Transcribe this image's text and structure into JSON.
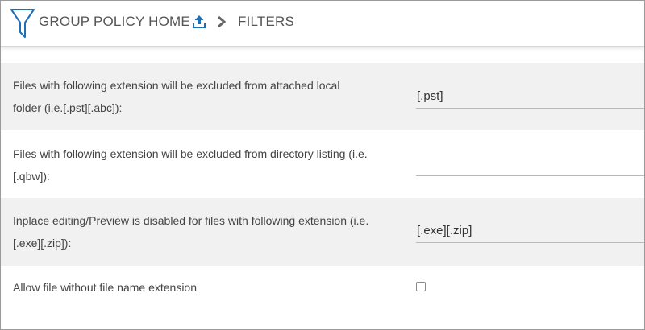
{
  "header": {
    "home_label": "GROUP POLICY HOME",
    "current_label": "FILTERS",
    "icons": {
      "logo": "filter-icon",
      "upload": "upload-icon",
      "separator": "chevron-right-icon"
    },
    "colors": {
      "accent": "#1f6fb5",
      "separator": "#666666"
    }
  },
  "settings": [
    {
      "label_line1": "Files with following extension will be excluded from attached local",
      "label_line2": "folder (i.e.[.pst][.abc]):",
      "value": "[.pst]"
    },
    {
      "label_line1": "Files with following extension will be excluded from directory listing (i.e.",
      "label_line2": "[.qbw]):",
      "value": ""
    },
    {
      "label_line1": "Inplace editing/Preview is disabled for files with following extension (i.e.",
      "label_line2": "[.exe][.zip]):",
      "value": "[.exe][.zip]"
    },
    {
      "label_line1": "Allow file without file name extension",
      "checked": false
    }
  ]
}
